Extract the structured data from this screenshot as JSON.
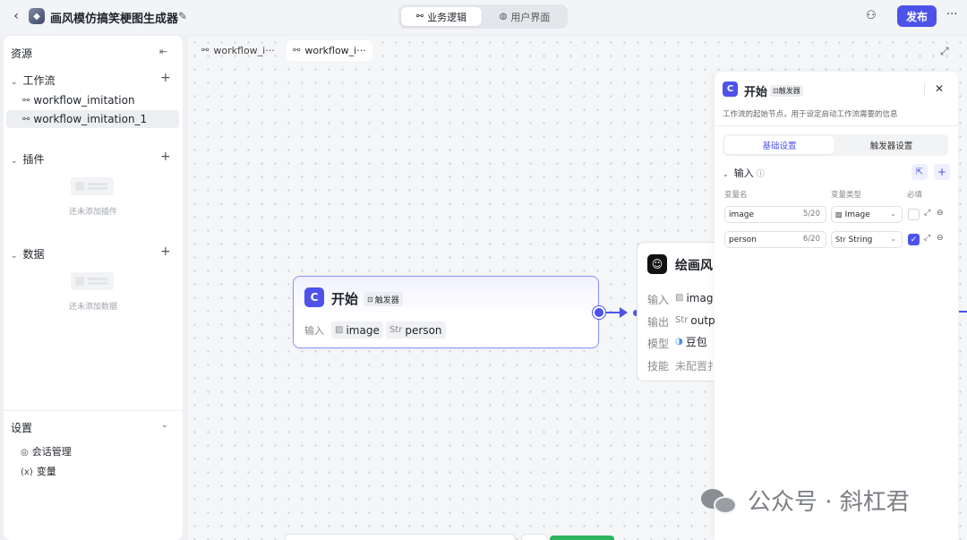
{
  "header": {
    "app_title": "画风模仿搞笑梗图生成器",
    "mode_tabs": [
      "业务逻辑",
      "用户界面"
    ],
    "publish_label": "发布",
    "more_label": "···"
  },
  "sidebar": {
    "title": "资源",
    "workflow_section": "工作流",
    "workflows": [
      "workflow_imitation",
      "workflow_imitation_1"
    ],
    "plugin_section": "插件",
    "plugin_empty": "还未添加插件",
    "data_section": "数据",
    "data_empty": "还未添加数据",
    "settings_section": "设置",
    "settings_items": [
      "会话管理",
      "变量"
    ]
  },
  "canvas": {
    "tabs": [
      "workflow_i···",
      "workflow_i···"
    ],
    "start_node": {
      "title": "开始",
      "badge": "触发器",
      "input_label": "输入",
      "inputs": [
        {
          "type_icon": "image-icon",
          "name": "image"
        },
        {
          "type_icon": "Str",
          "name": "person"
        }
      ]
    },
    "paint_node": {
      "title": "绘画风",
      "rows": [
        {
          "label": "输入",
          "value": "imag"
        },
        {
          "label": "输出",
          "value": "outp"
        },
        {
          "label": "模型",
          "value": "豆包"
        },
        {
          "label": "技能",
          "value": "未配置扌"
        }
      ]
    }
  },
  "panel": {
    "title": "开始",
    "badge": "触发器",
    "description": "工作流的起始节点，用于设定启动工作流需要的信息",
    "tabs": [
      "基础设置",
      "触发器设置"
    ],
    "input_section": "输入",
    "columns": [
      "变量名",
      "变量类型",
      "必填"
    ],
    "variables": [
      {
        "name": "image",
        "count": "5/20",
        "type": "Image",
        "type_icon": "image-icon",
        "required": false
      },
      {
        "name": "person",
        "count": "6/20",
        "type": "String",
        "type_icon": "Str",
        "required": true
      }
    ]
  },
  "watermark": "公众号 · 斜杠君"
}
